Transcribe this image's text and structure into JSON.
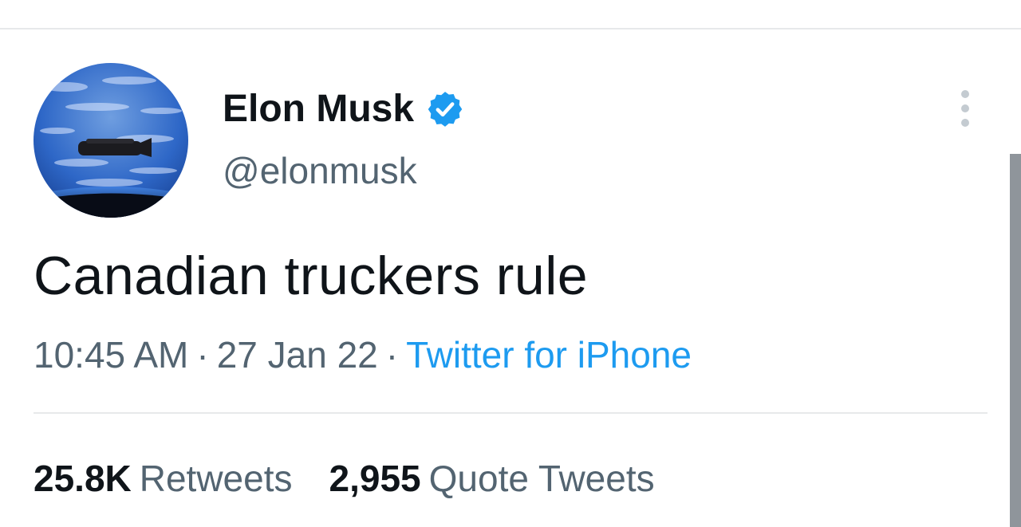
{
  "author": {
    "name": "Elon Musk",
    "handle": "@elonmusk",
    "verified": true
  },
  "tweet": {
    "text": "Canadian truckers rule",
    "time": "10:45 AM",
    "date": "27 Jan 22",
    "separator": "·",
    "source": "Twitter for iPhone"
  },
  "stats": {
    "retweets_count": "25.8K",
    "retweets_label": "Retweets",
    "quotes_count": "2,955",
    "quotes_label": "Quote Tweets"
  },
  "icons": {
    "verified": "verified-badge-icon",
    "more": "more-options-icon"
  },
  "colors": {
    "accent": "#1d9bf0",
    "text_primary": "#0f1419",
    "text_secondary": "#536471",
    "divider": "#e7e9ea"
  }
}
